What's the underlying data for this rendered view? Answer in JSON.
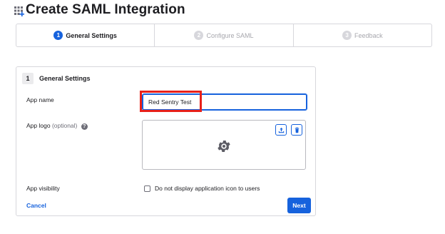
{
  "page": {
    "title": "Create SAML Integration",
    "title_icon": "apps-add-icon"
  },
  "stepper": {
    "steps": [
      {
        "number": "1",
        "label": "General Settings",
        "state": "active"
      },
      {
        "number": "2",
        "label": "Configure SAML",
        "state": "inactive"
      },
      {
        "number": "3",
        "label": "Feedback",
        "state": "inactive"
      }
    ]
  },
  "section": {
    "number": "1",
    "title": "General Settings",
    "app_name": {
      "label": "App name",
      "value": "Red Sentry Test"
    },
    "app_logo": {
      "label": "App logo",
      "optional": "(optional)",
      "help_icon": "question-circle-icon",
      "upload_icon": "upload-icon",
      "delete_icon": "trash-icon",
      "placeholder_icon": "gear-icon"
    },
    "app_visibility": {
      "label": "App visibility",
      "checkbox_label": "Do not display application icon to users",
      "checked": false
    },
    "cancel_label": "Cancel",
    "next_label": "Next"
  },
  "colors": {
    "accent": "#1662dd",
    "highlight": "#e8211a",
    "border": "#d7d7dc"
  }
}
